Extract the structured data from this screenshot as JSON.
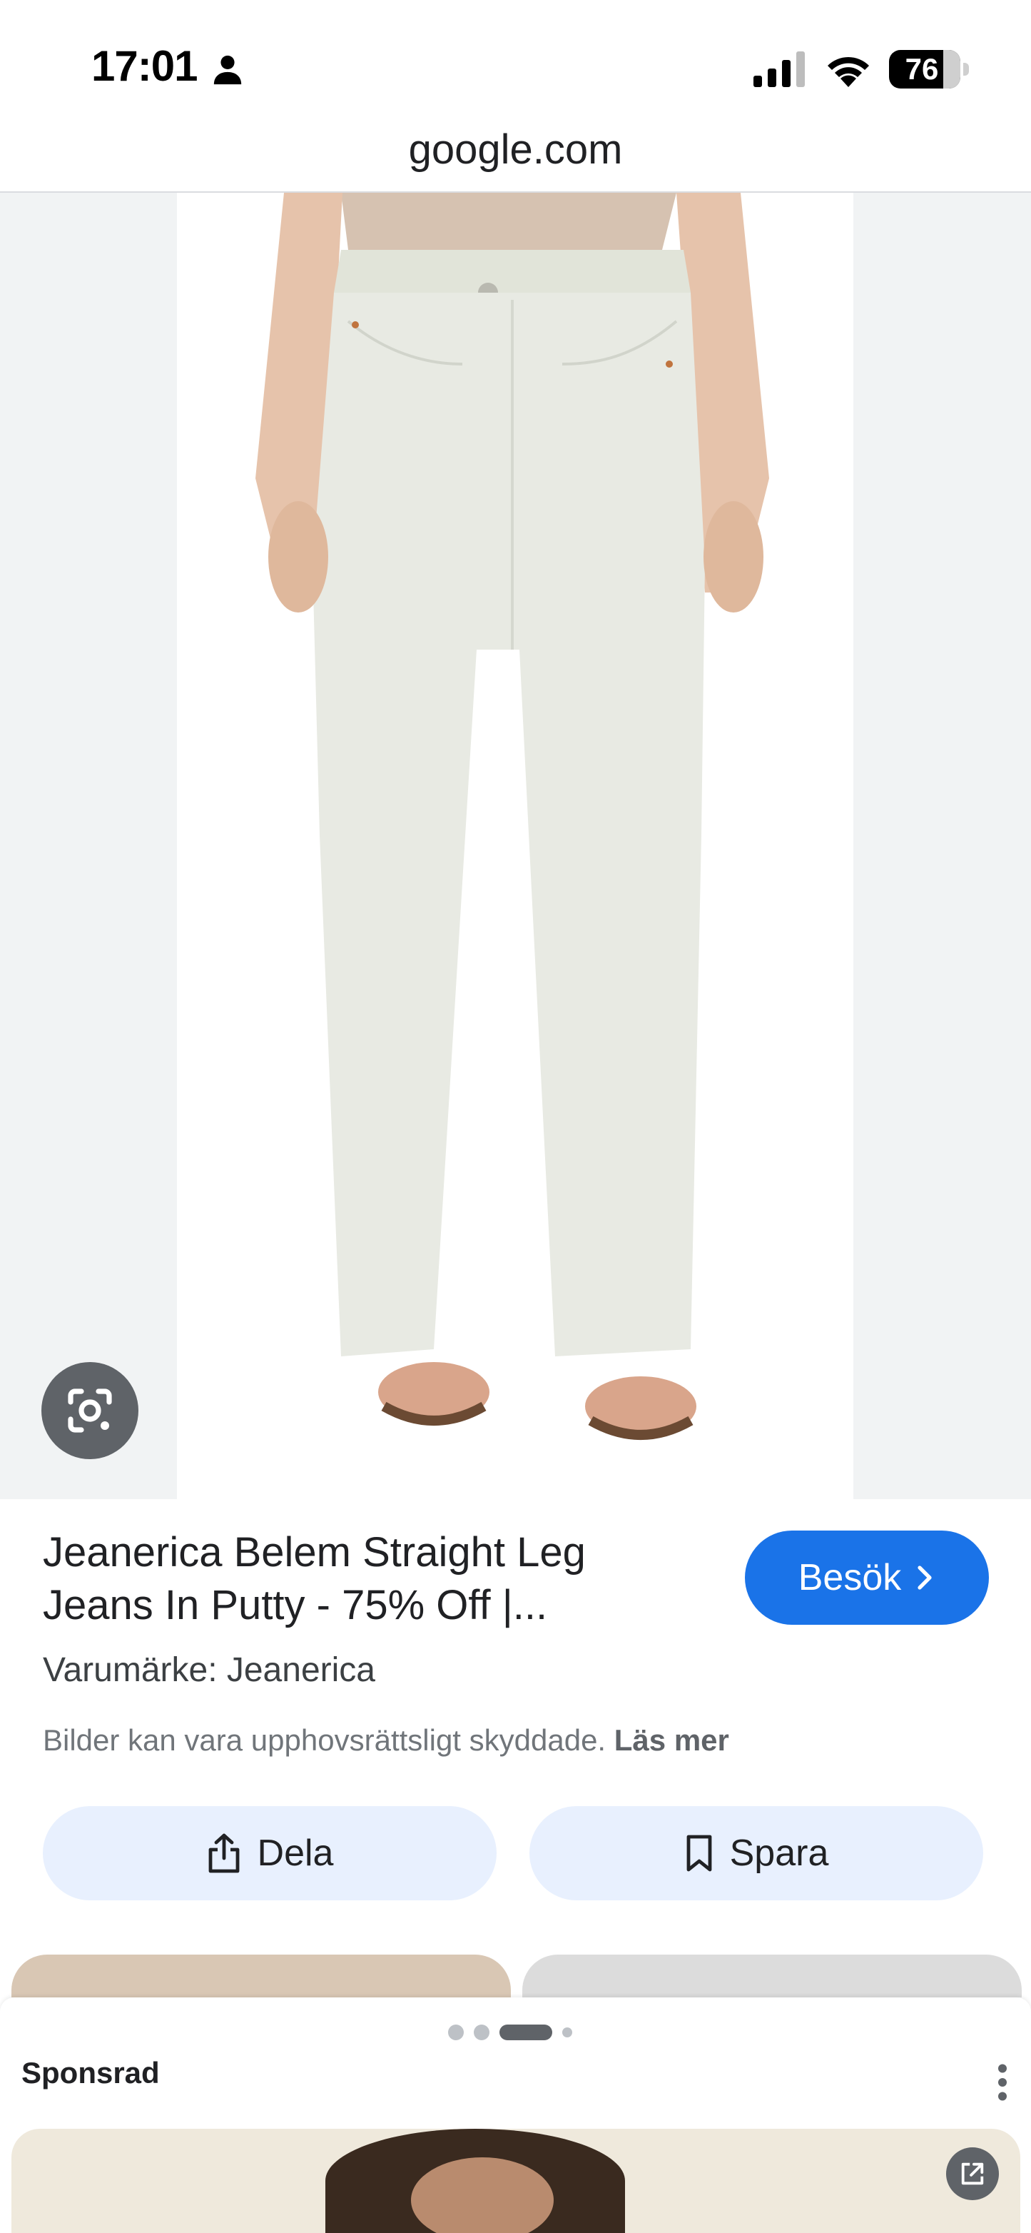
{
  "status_bar": {
    "time": "17:01",
    "battery_level": "76"
  },
  "browser": {
    "url": "google.com"
  },
  "hero": {
    "lens_icon": "google-lens-icon"
  },
  "product": {
    "title_line1": "Jeanerica Belem Straight Leg",
    "title_line2": "Jeans In Putty - 75% Off |...",
    "visit_label": "Besök",
    "brand": "Varumärke: Jeanerica",
    "copyright_text": "Bilder kan vara upphovsrättsligt skyddade.",
    "read_more": "Läs mer"
  },
  "actions": {
    "share_label": "Dela",
    "save_label": "Spara"
  },
  "bottom": {
    "sponsored_label": "Sponsrad"
  },
  "colors": {
    "accent": "#1a73e8",
    "chip_bg": "#e8f0fe",
    "text": "#202124"
  }
}
